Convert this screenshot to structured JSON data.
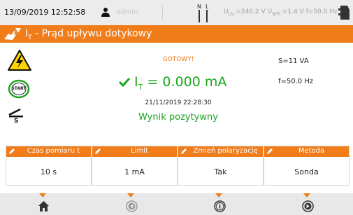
{
  "status_bar": {
    "datetime": "13/09/2019 12:52:58",
    "user": "admin",
    "phase_labels": {
      "n": "N",
      "l": "L"
    },
    "voltages": {
      "uln_label": "U",
      "uln_sub": "LN",
      "uln_value": " =240.2 V ",
      "unpe_label": "U",
      "unpe_sub": "NPE",
      "unpe_value": " =1.4 V ",
      "freq": "f=50.0 Hz"
    }
  },
  "title": {
    "symbol": "I",
    "symbol_sub": "T",
    "text": " - Prąd upływu dotykowy"
  },
  "main": {
    "status": "GOTOWY!",
    "result_symbol": "I",
    "result_sub": "T",
    "result_value": " = 0.000 mA",
    "timestamp": "21/11/2019 22:28:30",
    "verdict": "Wynik pozytywny",
    "start_label": "START",
    "probe_label": "S"
  },
  "side_values": {
    "apparent_power": "S=11 VA",
    "frequency": "f=50.0 Hz"
  },
  "params": [
    {
      "label": "Czas pomiaru t",
      "value": "10 s"
    },
    {
      "label": "Limit",
      "value": "1 mA"
    },
    {
      "label": "Zmień polaryzację",
      "value": "Tak"
    },
    {
      "label": "Metoda",
      "value": "Sonda"
    }
  ],
  "nav": [
    "home-icon",
    "back-icon",
    "info-icon",
    "forward-icon"
  ],
  "colors": {
    "accent": "#f07c1a",
    "pass": "#1ea51e",
    "statusbar_bg": "#ececec",
    "navbar_bg": "#e8e8e8"
  }
}
